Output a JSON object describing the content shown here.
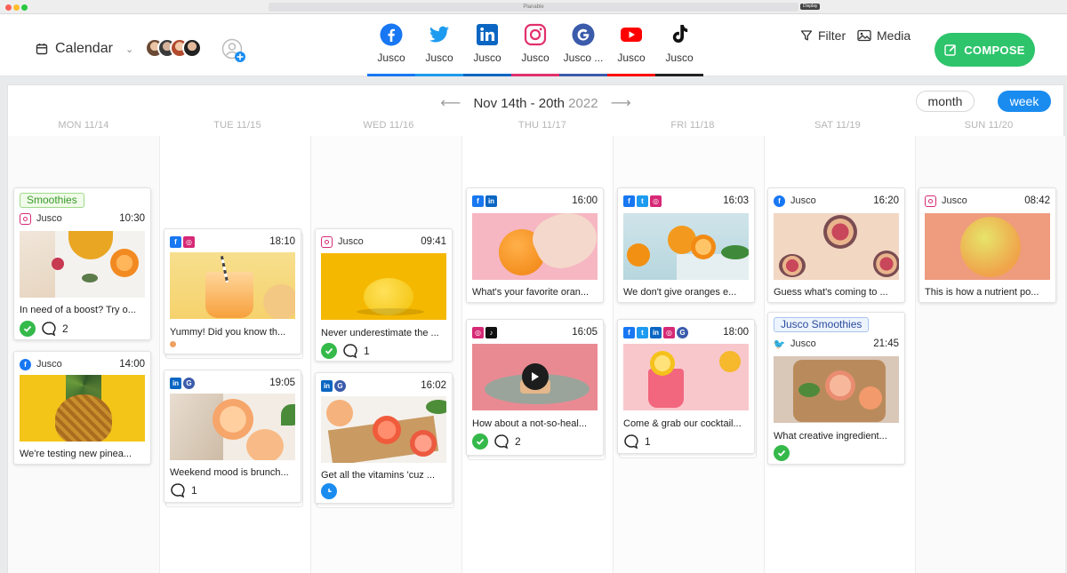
{
  "window": {
    "url": "Planable",
    "share_label": "Display"
  },
  "header": {
    "calendar_label": "Calendar",
    "networks": [
      {
        "icon": "facebook-icon",
        "label": "Jusco",
        "color": "#1877f2"
      },
      {
        "icon": "twitter-icon",
        "label": "Jusco",
        "color": "#1d9bf0"
      },
      {
        "icon": "linkedin-icon",
        "label": "Jusco",
        "color": "#0a66c2"
      },
      {
        "icon": "instagram-icon",
        "label": "Jusco",
        "color": "#e1306c"
      },
      {
        "icon": "google-icon",
        "label": "Jusco ...",
        "color": "#3b5bab"
      },
      {
        "icon": "youtube-icon",
        "label": "Jusco",
        "color": "#ff0000"
      },
      {
        "icon": "tiktok-icon",
        "label": "Jusco",
        "color": "#111111"
      }
    ],
    "filter_label": "Filter",
    "media_label": "Media",
    "compose_label": "COMPOSE"
  },
  "calendar": {
    "range_label": "Nov 14th - 20th",
    "range_year": "2022",
    "view_month": "month",
    "view_week": "week",
    "active_view": "week",
    "days": [
      "MON 11/14",
      "TUE 11/15",
      "WED 11/16",
      "THU 11/17",
      "FRI 11/18",
      "SAT 11/19",
      "SUN 11/20"
    ]
  },
  "posts": [
    {
      "day": "MON 11/14",
      "tag": "Smoothies",
      "networks": [
        "instagram"
      ],
      "account": "Jusco",
      "time": "10:30",
      "text": "In need of a boost? Try o...",
      "approved": true,
      "comments": "2",
      "image": "smoothie-flatlay"
    },
    {
      "day": "MON 11/14",
      "tag": "",
      "networks": [
        "facebook"
      ],
      "account": "Jusco",
      "time": "14:00",
      "text": "We're testing new pinea...",
      "approved": false,
      "comments": "",
      "image": "pineapple"
    },
    {
      "day": "TUE 11/15",
      "tag": "",
      "networks": [
        "facebook",
        "instagram"
      ],
      "account": "",
      "time": "18:10",
      "text": "Yummy! Did you know th...",
      "approved": false,
      "comments": "",
      "status_dot": true,
      "image": "juice-glass"
    },
    {
      "day": "TUE 11/15",
      "tag": "",
      "networks": [
        "linkedin",
        "google"
      ],
      "account": "",
      "time": "19:05",
      "text": "Weekend mood is brunch...",
      "approved": false,
      "comments": "1",
      "image": "brunch-drinks"
    },
    {
      "day": "WED 11/16",
      "tag": "",
      "networks": [
        "instagram"
      ],
      "account": "Jusco",
      "time": "09:41",
      "text": "Never underestimate the ...",
      "approved": true,
      "comments": "1",
      "image": "lemon"
    },
    {
      "day": "WED 11/16",
      "tag": "",
      "networks": [
        "linkedin",
        "google"
      ],
      "account": "",
      "time": "16:02",
      "text": "Get all the vitamins 'cuz ...",
      "approved": false,
      "comments": "",
      "scheduled": true,
      "image": "grapefruit-board"
    },
    {
      "day": "THU 11/17",
      "tag": "",
      "networks": [
        "facebook",
        "linkedin"
      ],
      "account": "",
      "time": "16:00",
      "text": "What's your favorite oran...",
      "approved": false,
      "comments": "",
      "image": "hand-orange"
    },
    {
      "day": "THU 11/17",
      "tag": "",
      "networks": [
        "instagram",
        "tiktok"
      ],
      "account": "",
      "time": "16:05",
      "text": "How about a not-so-heal...",
      "approved": true,
      "comments": "2",
      "video": true,
      "image": "plate-video"
    },
    {
      "day": "FRI 11/18",
      "tag": "",
      "networks": [
        "facebook",
        "twitter",
        "instagram"
      ],
      "account": "",
      "time": "16:03",
      "text": "We don't give oranges e...",
      "approved": false,
      "comments": "",
      "image": "oranges-stand"
    },
    {
      "day": "FRI 11/18",
      "tag": "",
      "networks": [
        "facebook",
        "twitter",
        "linkedin",
        "instagram",
        "google"
      ],
      "account": "",
      "time": "18:00",
      "text": "Come & grab our cocktail...",
      "approved": false,
      "comments": "1",
      "image": "pink-cocktail"
    },
    {
      "day": "SAT 11/19",
      "tag": "",
      "networks": [
        "facebook"
      ],
      "account": "Jusco",
      "time": "16:20",
      "text": "Guess what's coming to ...",
      "approved": false,
      "comments": "",
      "image": "figs"
    },
    {
      "day": "SAT 11/19",
      "tag": "Jusco Smoothies",
      "networks": [
        "twitter"
      ],
      "account": "Jusco",
      "time": "21:45",
      "text": "What creative ingredient...",
      "approved": true,
      "comments": "",
      "image": "grapefruit-platter"
    },
    {
      "day": "SUN 11/20",
      "tag": "",
      "networks": [
        "instagram"
      ],
      "account": "Jusco",
      "time": "08:42",
      "text": "This is how a nutrient po...",
      "approved": false,
      "comments": "",
      "image": "grapefruit"
    }
  ]
}
